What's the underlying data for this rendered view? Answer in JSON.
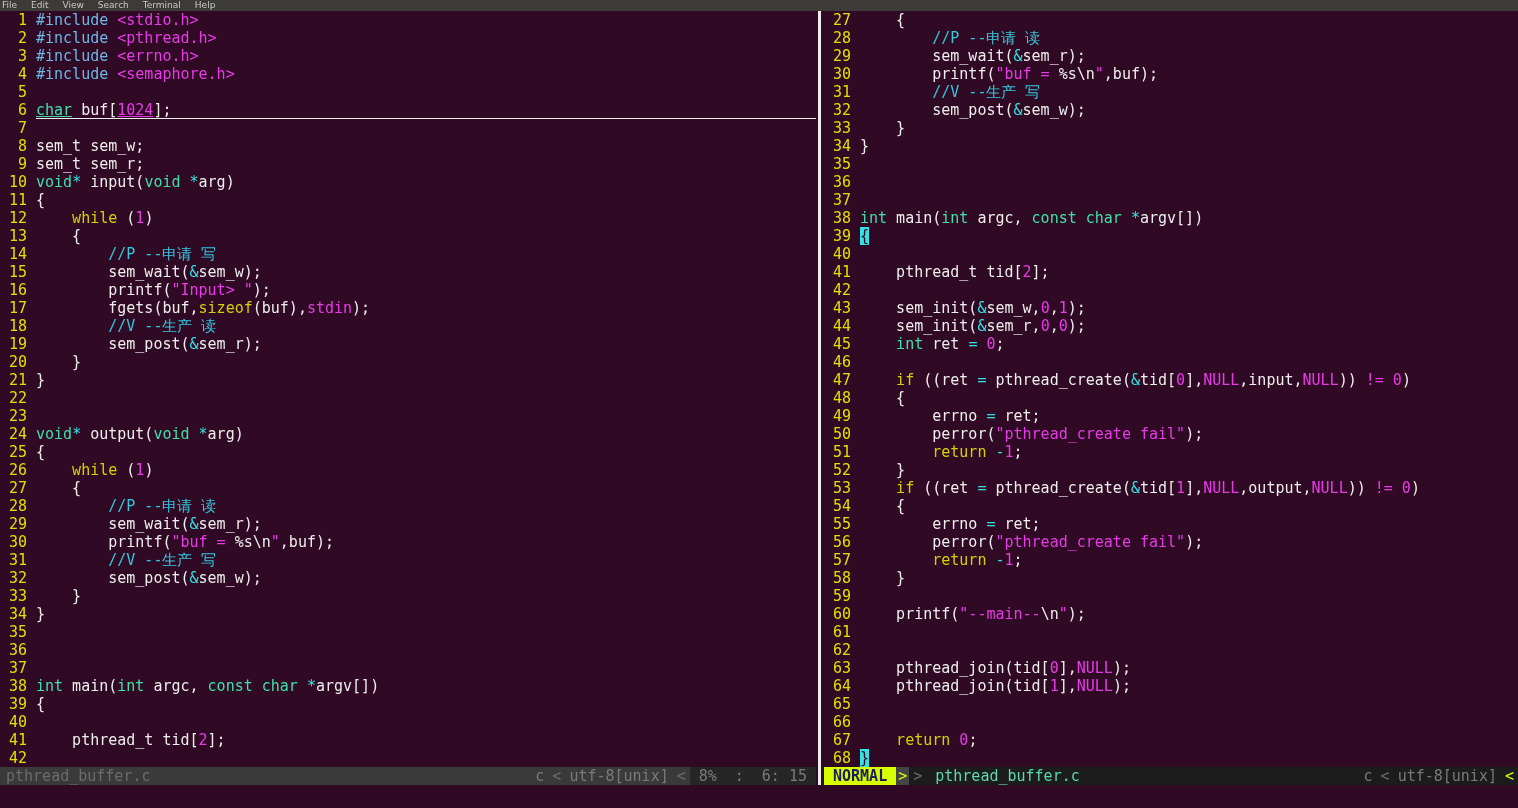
{
  "menu": [
    "File",
    "Edit",
    "View",
    "Search",
    "Terminal",
    "Help"
  ],
  "panes": [
    {
      "lines": [
        {
          "n": "1",
          "cursor": false,
          "t": [
            {
              "kind": "pp",
              "text": "#include "
            },
            {
              "kind": "s",
              "text": "<stdio.h>"
            }
          ]
        },
        {
          "n": "2",
          "cursor": false,
          "t": [
            {
              "kind": "pp",
              "text": "#include "
            },
            {
              "kind": "s",
              "text": "<pthread.h>"
            }
          ]
        },
        {
          "n": "3",
          "cursor": false,
          "t": [
            {
              "kind": "pp",
              "text": "#include "
            },
            {
              "kind": "s",
              "text": "<errno.h>"
            }
          ]
        },
        {
          "n": "4",
          "cursor": false,
          "t": [
            {
              "kind": "pp",
              "text": "#include "
            },
            {
              "kind": "s",
              "text": "<semaphore.h>"
            }
          ]
        },
        {
          "n": "5",
          "cursor": false
        },
        {
          "n": "6",
          "cursor": true,
          "t": [
            {
              "kind": "t",
              "text": "char"
            },
            {
              "kind": "p",
              "text": " buf["
            },
            {
              "kind": "n",
              "text": "1024"
            },
            {
              "kind": "p",
              "text": "];"
            }
          ]
        },
        {
          "n": "7",
          "cursor": false
        },
        {
          "n": "8",
          "cursor": false,
          "t": [
            {
              "kind": "p",
              "text": "sem_t sem_w;"
            }
          ]
        },
        {
          "n": "9",
          "cursor": false,
          "t": [
            {
              "kind": "p",
              "text": "sem_t sem_r;"
            }
          ]
        },
        {
          "n": "10",
          "cursor": false,
          "t": [
            {
              "kind": "t",
              "text": "void"
            },
            {
              "kind": "o",
              "text": "*"
            },
            {
              "kind": "p",
              "text": " input("
            },
            {
              "kind": "t",
              "text": "void "
            },
            {
              "kind": "o",
              "text": "*"
            },
            {
              "kind": "p",
              "text": "arg)"
            }
          ]
        },
        {
          "n": "11",
          "cursor": false,
          "t": [
            {
              "kind": "p",
              "text": "{"
            }
          ]
        },
        {
          "n": "12",
          "cursor": false,
          "t": [
            {
              "kind": "k",
              "text": "    while"
            },
            {
              "kind": "p",
              "text": " ("
            },
            {
              "kind": "n",
              "text": "1"
            },
            {
              "kind": "p",
              "text": ")"
            }
          ]
        },
        {
          "n": "13",
          "cursor": false,
          "t": [
            {
              "kind": "p",
              "text": "    {"
            }
          ]
        },
        {
          "n": "14",
          "cursor": false,
          "t": [
            {
              "kind": "c",
              "text": "        //P --申请 写"
            }
          ]
        },
        {
          "n": "15",
          "cursor": false,
          "t": [
            {
              "kind": "p",
              "text": "        sem_wait("
            },
            {
              "kind": "o",
              "text": "&"
            },
            {
              "kind": "p",
              "text": "sem_w);"
            }
          ]
        },
        {
          "n": "16",
          "cursor": false,
          "t": [
            {
              "kind": "p",
              "text": "        printf("
            },
            {
              "kind": "s",
              "text": "\"Input> \""
            },
            {
              "kind": "p",
              "text": ");"
            }
          ]
        },
        {
          "n": "17",
          "cursor": false,
          "t": [
            {
              "kind": "p",
              "text": "        fgets(buf,"
            },
            {
              "kind": "k",
              "text": "sizeof"
            },
            {
              "kind": "p",
              "text": "(buf),"
            },
            {
              "kind": "n",
              "text": "stdin"
            },
            {
              "kind": "p",
              "text": ");"
            }
          ]
        },
        {
          "n": "18",
          "cursor": false,
          "t": [
            {
              "kind": "c",
              "text": "        //V --生产 读"
            }
          ]
        },
        {
          "n": "19",
          "cursor": false,
          "t": [
            {
              "kind": "p",
              "text": "        sem_post("
            },
            {
              "kind": "o",
              "text": "&"
            },
            {
              "kind": "p",
              "text": "sem_r);"
            }
          ]
        },
        {
          "n": "20",
          "cursor": false,
          "t": [
            {
              "kind": "p",
              "text": "    }"
            }
          ]
        },
        {
          "n": "21",
          "cursor": false,
          "t": [
            {
              "kind": "p",
              "text": "}"
            }
          ]
        },
        {
          "n": "22",
          "cursor": false
        },
        {
          "n": "23",
          "cursor": false
        },
        {
          "n": "24",
          "cursor": false,
          "t": [
            {
              "kind": "t",
              "text": "void"
            },
            {
              "kind": "o",
              "text": "*"
            },
            {
              "kind": "p",
              "text": " output("
            },
            {
              "kind": "t",
              "text": "void "
            },
            {
              "kind": "o",
              "text": "*"
            },
            {
              "kind": "p",
              "text": "arg)"
            }
          ]
        },
        {
          "n": "25",
          "cursor": false,
          "t": [
            {
              "kind": "p",
              "text": "{"
            }
          ]
        },
        {
          "n": "26",
          "cursor": false,
          "t": [
            {
              "kind": "k",
              "text": "    while"
            },
            {
              "kind": "p",
              "text": " ("
            },
            {
              "kind": "n",
              "text": "1"
            },
            {
              "kind": "p",
              "text": ")"
            }
          ]
        },
        {
          "n": "27",
          "cursor": false,
          "t": [
            {
              "kind": "p",
              "text": "    {"
            }
          ]
        },
        {
          "n": "28",
          "cursor": false,
          "t": [
            {
              "kind": "c",
              "text": "        //P --申请 读"
            }
          ]
        },
        {
          "n": "29",
          "cursor": false,
          "t": [
            {
              "kind": "p",
              "text": "        sem_wait("
            },
            {
              "kind": "o",
              "text": "&"
            },
            {
              "kind": "p",
              "text": "sem_r);"
            }
          ]
        },
        {
          "n": "30",
          "cursor": false,
          "t": [
            {
              "kind": "p",
              "text": "        printf("
            },
            {
              "kind": "s",
              "text": "\"buf = "
            },
            {
              "kind": "e",
              "text": "%s\\n"
            },
            {
              "kind": "s",
              "text": "\""
            },
            {
              "kind": "p",
              "text": ",buf);"
            }
          ]
        },
        {
          "n": "31",
          "cursor": false,
          "t": [
            {
              "kind": "c",
              "text": "        //V --生产 写"
            }
          ]
        },
        {
          "n": "32",
          "cursor": false,
          "t": [
            {
              "kind": "p",
              "text": "        sem_post("
            },
            {
              "kind": "o",
              "text": "&"
            },
            {
              "kind": "p",
              "text": "sem_w);"
            }
          ]
        },
        {
          "n": "33",
          "cursor": false,
          "t": [
            {
              "kind": "p",
              "text": "    }"
            }
          ]
        },
        {
          "n": "34",
          "cursor": false,
          "t": [
            {
              "kind": "p",
              "text": "}"
            }
          ]
        },
        {
          "n": "35",
          "cursor": false
        },
        {
          "n": "36",
          "cursor": false
        },
        {
          "n": "37",
          "cursor": false
        },
        {
          "n": "38",
          "cursor": false,
          "t": [
            {
              "kind": "t",
              "text": "int"
            },
            {
              "kind": "p",
              "text": " main("
            },
            {
              "kind": "t",
              "text": "int"
            },
            {
              "kind": "p",
              "text": " argc, "
            },
            {
              "kind": "t",
              "text": "const char "
            },
            {
              "kind": "o",
              "text": "*"
            },
            {
              "kind": "p",
              "text": "argv[])"
            }
          ]
        },
        {
          "n": "39",
          "cursor": false,
          "t": [
            {
              "kind": "p",
              "text": "{"
            }
          ]
        },
        {
          "n": "40",
          "cursor": false
        },
        {
          "n": "41",
          "cursor": false,
          "t": [
            {
              "kind": "p",
              "text": "    pthread_t tid["
            },
            {
              "kind": "n",
              "text": "2"
            },
            {
              "kind": "p",
              "text": "];"
            }
          ]
        },
        {
          "n": "42",
          "cursor": false
        }
      ],
      "status": {
        "left": [
          {
            "kind": "file",
            "text": "pthread_buffer.c"
          }
        ],
        "right": [
          {
            "kind": "text",
            "text": "c"
          },
          {
            "kind": "sep",
            "text": "<"
          },
          {
            "kind": "text",
            "text": "utf-8[unix]"
          },
          {
            "kind": "sep",
            "text": "<"
          },
          {
            "kind": "info",
            "text": "8%"
          },
          {
            "kind": "info",
            "text": ":"
          },
          {
            "kind": "info",
            "text": "6: 15"
          }
        ]
      }
    },
    {
      "lines": [
        {
          "n": "27",
          "cursor": false,
          "t": [
            {
              "kind": "p",
              "text": "    {"
            }
          ]
        },
        {
          "n": "28",
          "cursor": false,
          "t": [
            {
              "kind": "c",
              "text": "        //P --申请 读"
            }
          ]
        },
        {
          "n": "29",
          "cursor": false,
          "t": [
            {
              "kind": "p",
              "text": "        sem_wait("
            },
            {
              "kind": "o",
              "text": "&"
            },
            {
              "kind": "p",
              "text": "sem_r);"
            }
          ]
        },
        {
          "n": "30",
          "cursor": false,
          "t": [
            {
              "kind": "p",
              "text": "        printf("
            },
            {
              "kind": "s",
              "text": "\"buf = "
            },
            {
              "kind": "e",
              "text": "%s\\n"
            },
            {
              "kind": "s",
              "text": "\""
            },
            {
              "kind": "p",
              "text": ",buf);"
            }
          ]
        },
        {
          "n": "31",
          "cursor": false,
          "t": [
            {
              "kind": "c",
              "text": "        //V --生产 写"
            }
          ]
        },
        {
          "n": "32",
          "cursor": false,
          "t": [
            {
              "kind": "p",
              "text": "        sem_post("
            },
            {
              "kind": "o",
              "text": "&"
            },
            {
              "kind": "p",
              "text": "sem_w);"
            }
          ]
        },
        {
          "n": "33",
          "cursor": false,
          "t": [
            {
              "kind": "p",
              "text": "    }"
            }
          ]
        },
        {
          "n": "34",
          "cursor": false,
          "t": [
            {
              "kind": "p",
              "text": "}"
            }
          ]
        },
        {
          "n": "35",
          "cursor": false
        },
        {
          "n": "36",
          "cursor": false
        },
        {
          "n": "37",
          "cursor": false
        },
        {
          "n": "38",
          "cursor": false,
          "t": [
            {
              "kind": "t",
              "text": "int"
            },
            {
              "kind": "p",
              "text": " main("
            },
            {
              "kind": "t",
              "text": "int"
            },
            {
              "kind": "p",
              "text": " argc, "
            },
            {
              "kind": "t",
              "text": "const char "
            },
            {
              "kind": "o",
              "text": "*"
            },
            {
              "kind": "p",
              "text": "argv[])"
            }
          ]
        },
        {
          "n": "39",
          "cursor": false,
          "t": [
            {
              "kind": "m",
              "text": "{"
            }
          ]
        },
        {
          "n": "40",
          "cursor": false
        },
        {
          "n": "41",
          "cursor": false,
          "t": [
            {
              "kind": "p",
              "text": "    pthread_t tid["
            },
            {
              "kind": "n",
              "text": "2"
            },
            {
              "kind": "p",
              "text": "];"
            }
          ]
        },
        {
          "n": "42",
          "cursor": false
        },
        {
          "n": "43",
          "cursor": false,
          "t": [
            {
              "kind": "p",
              "text": "    sem_init("
            },
            {
              "kind": "o",
              "text": "&"
            },
            {
              "kind": "p",
              "text": "sem_w,"
            },
            {
              "kind": "n",
              "text": "0"
            },
            {
              "kind": "p",
              "text": ","
            },
            {
              "kind": "n",
              "text": "1"
            },
            {
              "kind": "p",
              "text": ");"
            }
          ]
        },
        {
          "n": "44",
          "cursor": false,
          "t": [
            {
              "kind": "p",
              "text": "    sem_init("
            },
            {
              "kind": "o",
              "text": "&"
            },
            {
              "kind": "p",
              "text": "sem_r,"
            },
            {
              "kind": "n",
              "text": "0"
            },
            {
              "kind": "p",
              "text": ","
            },
            {
              "kind": "n",
              "text": "0"
            },
            {
              "kind": "p",
              "text": ");"
            }
          ]
        },
        {
          "n": "45",
          "cursor": false,
          "t": [
            {
              "kind": "t",
              "text": "    int"
            },
            {
              "kind": "p",
              "text": " ret "
            },
            {
              "kind": "o",
              "text": "="
            },
            {
              "kind": "n",
              "text": " 0"
            },
            {
              "kind": "p",
              "text": ";"
            }
          ]
        },
        {
          "n": "46",
          "cursor": false
        },
        {
          "n": "47",
          "cursor": false,
          "t": [
            {
              "kind": "k",
              "text": "    if"
            },
            {
              "kind": "p",
              "text": " ((ret "
            },
            {
              "kind": "o",
              "text": "="
            },
            {
              "kind": "p",
              "text": " pthread_create("
            },
            {
              "kind": "o",
              "text": "&"
            },
            {
              "kind": "p",
              "text": "tid["
            },
            {
              "kind": "n",
              "text": "0"
            },
            {
              "kind": "p",
              "text": "],"
            },
            {
              "kind": "n",
              "text": "NULL"
            },
            {
              "kind": "p",
              "text": ",input,"
            },
            {
              "kind": "n",
              "text": "NULL"
            },
            {
              "kind": "p",
              "text": ")) "
            },
            {
              "kind": "n",
              "text": "!= 0"
            },
            {
              "kind": "p",
              "text": ")"
            }
          ]
        },
        {
          "n": "48",
          "cursor": false,
          "t": [
            {
              "kind": "p",
              "text": "    {"
            }
          ]
        },
        {
          "n": "49",
          "cursor": false,
          "t": [
            {
              "kind": "p",
              "text": "        errno "
            },
            {
              "kind": "o",
              "text": "="
            },
            {
              "kind": "p",
              "text": " ret;"
            }
          ]
        },
        {
          "n": "50",
          "cursor": false,
          "t": [
            {
              "kind": "p",
              "text": "        perror("
            },
            {
              "kind": "s",
              "text": "\"pthread_create fail\""
            },
            {
              "kind": "p",
              "text": ");"
            }
          ]
        },
        {
          "n": "51",
          "cursor": false,
          "t": [
            {
              "kind": "k",
              "text": "        return"
            },
            {
              "kind": "o",
              "text": " -"
            },
            {
              "kind": "n",
              "text": "1"
            },
            {
              "kind": "p",
              "text": ";"
            }
          ]
        },
        {
          "n": "52",
          "cursor": false,
          "t": [
            {
              "kind": "p",
              "text": "    }"
            }
          ]
        },
        {
          "n": "53",
          "cursor": false,
          "t": [
            {
              "kind": "k",
              "text": "    if"
            },
            {
              "kind": "p",
              "text": " ((ret "
            },
            {
              "kind": "o",
              "text": "="
            },
            {
              "kind": "p",
              "text": " pthread_create("
            },
            {
              "kind": "o",
              "text": "&"
            },
            {
              "kind": "p",
              "text": "tid["
            },
            {
              "kind": "n",
              "text": "1"
            },
            {
              "kind": "p",
              "text": "],"
            },
            {
              "kind": "n",
              "text": "NULL"
            },
            {
              "kind": "p",
              "text": ",output,"
            },
            {
              "kind": "n",
              "text": "NULL"
            },
            {
              "kind": "p",
              "text": ")) "
            },
            {
              "kind": "n",
              "text": "!= 0"
            },
            {
              "kind": "p",
              "text": ")"
            }
          ]
        },
        {
          "n": "54",
          "cursor": false,
          "t": [
            {
              "kind": "p",
              "text": "    {"
            }
          ]
        },
        {
          "n": "55",
          "cursor": false,
          "t": [
            {
              "kind": "p",
              "text": "        errno "
            },
            {
              "kind": "o",
              "text": "="
            },
            {
              "kind": "p",
              "text": " ret;"
            }
          ]
        },
        {
          "n": "56",
          "cursor": false,
          "t": [
            {
              "kind": "p",
              "text": "        perror("
            },
            {
              "kind": "s",
              "text": "\"pthread_create fail\""
            },
            {
              "kind": "p",
              "text": ");"
            }
          ]
        },
        {
          "n": "57",
          "cursor": false,
          "t": [
            {
              "kind": "k",
              "text": "        return"
            },
            {
              "kind": "o",
              "text": " -"
            },
            {
              "kind": "n",
              "text": "1"
            },
            {
              "kind": "p",
              "text": ";"
            }
          ]
        },
        {
          "n": "58",
          "cursor": false,
          "t": [
            {
              "kind": "p",
              "text": "    }"
            }
          ]
        },
        {
          "n": "59",
          "cursor": false
        },
        {
          "n": "60",
          "cursor": false,
          "t": [
            {
              "kind": "p",
              "text": "    printf("
            },
            {
              "kind": "s",
              "text": "\"--main--"
            },
            {
              "kind": "e",
              "text": "\\n"
            },
            {
              "kind": "s",
              "text": "\""
            },
            {
              "kind": "p",
              "text": ");"
            }
          ]
        },
        {
          "n": "61",
          "cursor": false
        },
        {
          "n": "62",
          "cursor": false
        },
        {
          "n": "63",
          "cursor": false,
          "t": [
            {
              "kind": "p",
              "text": "    pthread_join(tid["
            },
            {
              "kind": "n",
              "text": "0"
            },
            {
              "kind": "p",
              "text": "],"
            },
            {
              "kind": "n",
              "text": "NULL"
            },
            {
              "kind": "p",
              "text": ");"
            }
          ]
        },
        {
          "n": "64",
          "cursor": false,
          "t": [
            {
              "kind": "p",
              "text": "    pthread_join(tid["
            },
            {
              "kind": "n",
              "text": "1"
            },
            {
              "kind": "p",
              "text": "],"
            },
            {
              "kind": "n",
              "text": "NULL"
            },
            {
              "kind": "p",
              "text": ");"
            }
          ]
        },
        {
          "n": "65",
          "cursor": false
        },
        {
          "n": "66",
          "cursor": false
        },
        {
          "n": "67",
          "cursor": false,
          "t": [
            {
              "kind": "k",
              "text": "    return"
            },
            {
              "kind": "n",
              "text": " 0"
            },
            {
              "kind": "p",
              "text": ";"
            }
          ]
        },
        {
          "n": "68",
          "cursor": false,
          "t": [
            {
              "kind": "m",
              "text": "}"
            }
          ]
        }
      ],
      "status": {
        "left": [
          {
            "kind": "mode",
            "text": "NORMAL"
          },
          {
            "kind": "mode-sep",
            "text": ">"
          },
          {
            "kind": "sep",
            "text": ">"
          },
          {
            "kind": "file",
            "text": "pthread_buffer.c"
          }
        ],
        "right": [
          {
            "kind": "text",
            "text": "c"
          },
          {
            "kind": "sep",
            "text": "<"
          },
          {
            "kind": "text",
            "text": "utf-8[unix]"
          },
          {
            "kind": "accent",
            "text": "<"
          }
        ]
      }
    }
  ]
}
